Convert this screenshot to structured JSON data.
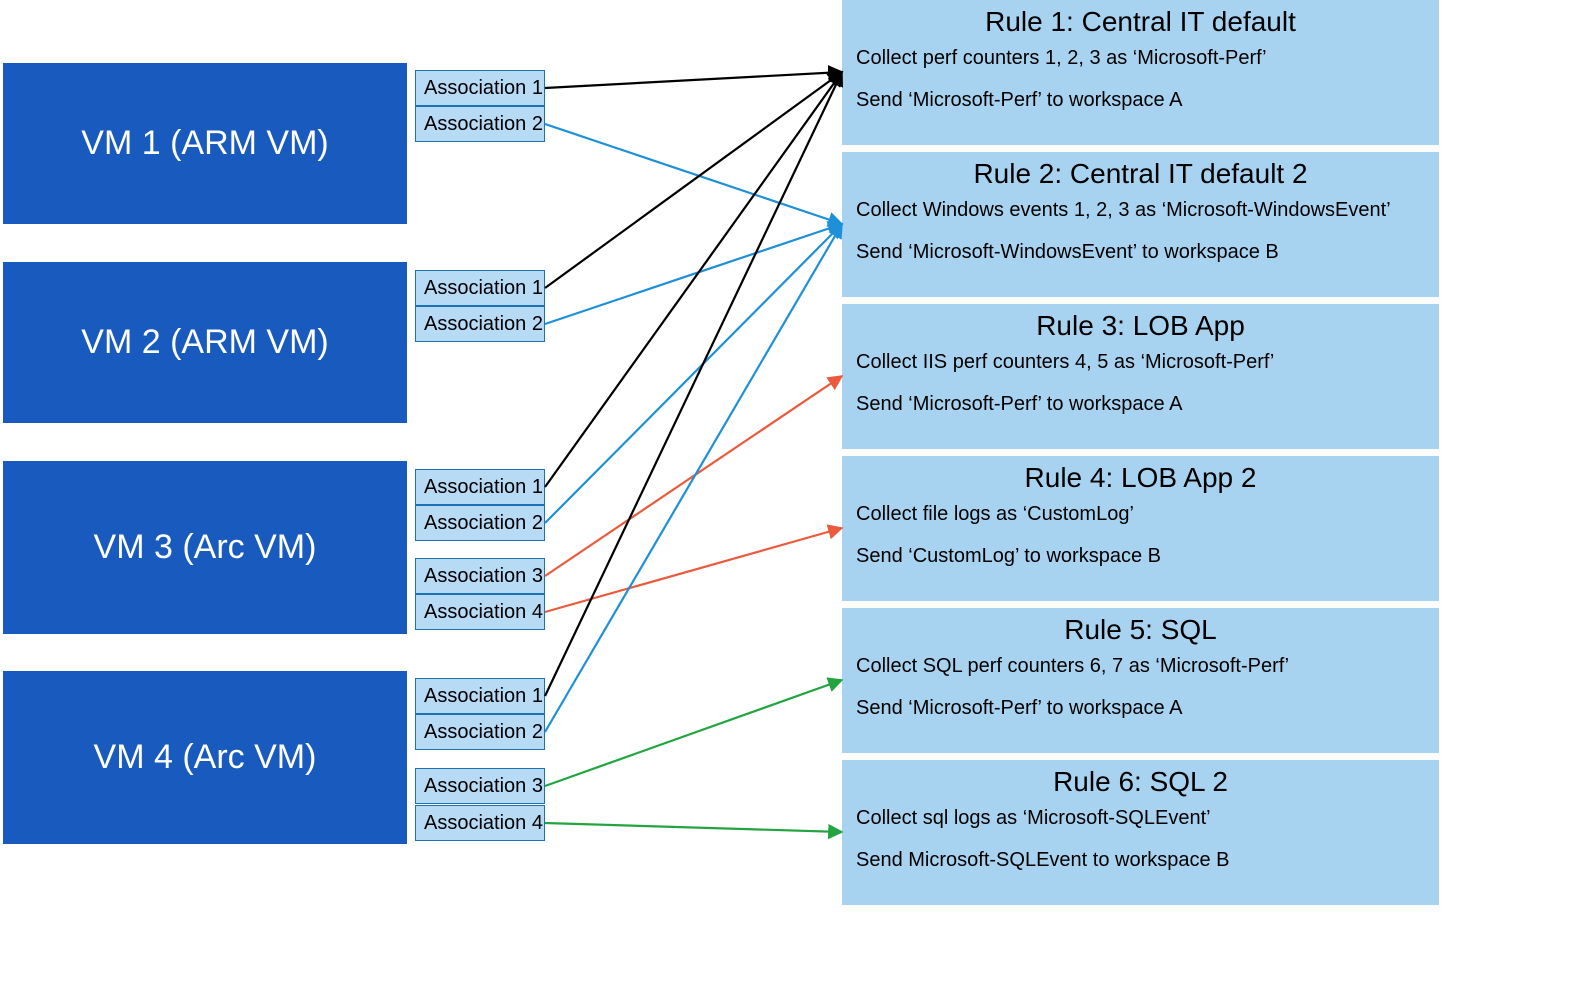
{
  "vms": [
    {
      "label": "VM 1 (ARM VM)"
    },
    {
      "label": "VM 2 (ARM VM)"
    },
    {
      "label": "VM 3 (Arc VM)"
    },
    {
      "label": "VM 4 (Arc VM)"
    }
  ],
  "assoc_labels": {
    "a1": "Association 1",
    "a2": "Association 2",
    "a3": "Association 3",
    "a4": "Association 4"
  },
  "rules": [
    {
      "title": "Rule 1: Central IT default",
      "line1": "Collect perf counters 1, 2, 3 as ‘Microsoft-Perf’",
      "line2": "Send ‘Microsoft-Perf’ to workspace A"
    },
    {
      "title": "Rule 2: Central IT default 2",
      "line1": "Collect Windows events 1, 2, 3 as ‘Microsoft-WindowsEvent’",
      "line2": "Send ‘Microsoft-WindowsEvent’ to workspace B"
    },
    {
      "title": "Rule 3: LOB App",
      "line1": "Collect IIS perf counters 4, 5 as ‘Microsoft-Perf’",
      "line2": "Send ‘Microsoft-Perf’ to workspace A"
    },
    {
      "title": "Rule 4: LOB App 2",
      "line1": "Collect file logs as ‘CustomLog’",
      "line2": "Send ‘CustomLog’ to workspace B"
    },
    {
      "title": "Rule 5: SQL",
      "line1": "Collect SQL perf counters 6, 7 as ‘Microsoft-Perf’",
      "line2": "Send ‘Microsoft-Perf’ to workspace A"
    },
    {
      "title": "Rule 6: SQL 2",
      "line1": "Collect sql logs as ‘Microsoft-SQLEvent’",
      "line2": "Send Microsoft-SQLEvent to workspace B"
    }
  ],
  "arrows": [
    {
      "fromVm": 0,
      "fromAssoc": 0,
      "toRule": 0,
      "color": "black"
    },
    {
      "fromVm": 0,
      "fromAssoc": 1,
      "toRule": 1,
      "color": "blue"
    },
    {
      "fromVm": 1,
      "fromAssoc": 0,
      "toRule": 0,
      "color": "black"
    },
    {
      "fromVm": 1,
      "fromAssoc": 1,
      "toRule": 1,
      "color": "blue"
    },
    {
      "fromVm": 2,
      "fromAssoc": 0,
      "toRule": 0,
      "color": "black"
    },
    {
      "fromVm": 2,
      "fromAssoc": 1,
      "toRule": 1,
      "color": "blue"
    },
    {
      "fromVm": 2,
      "fromAssoc": 2,
      "toRule": 2,
      "color": "red"
    },
    {
      "fromVm": 2,
      "fromAssoc": 3,
      "toRule": 3,
      "color": "red"
    },
    {
      "fromVm": 3,
      "fromAssoc": 0,
      "toRule": 0,
      "color": "black"
    },
    {
      "fromVm": 3,
      "fromAssoc": 1,
      "toRule": 1,
      "color": "blue"
    },
    {
      "fromVm": 3,
      "fromAssoc": 2,
      "toRule": 4,
      "color": "green"
    },
    {
      "fromVm": 3,
      "fromAssoc": 3,
      "toRule": 5,
      "color": "green"
    }
  ],
  "colors": {
    "black": "#000000",
    "blue": "#1e90d8",
    "red": "#eb5a3c",
    "green": "#22a53f"
  }
}
